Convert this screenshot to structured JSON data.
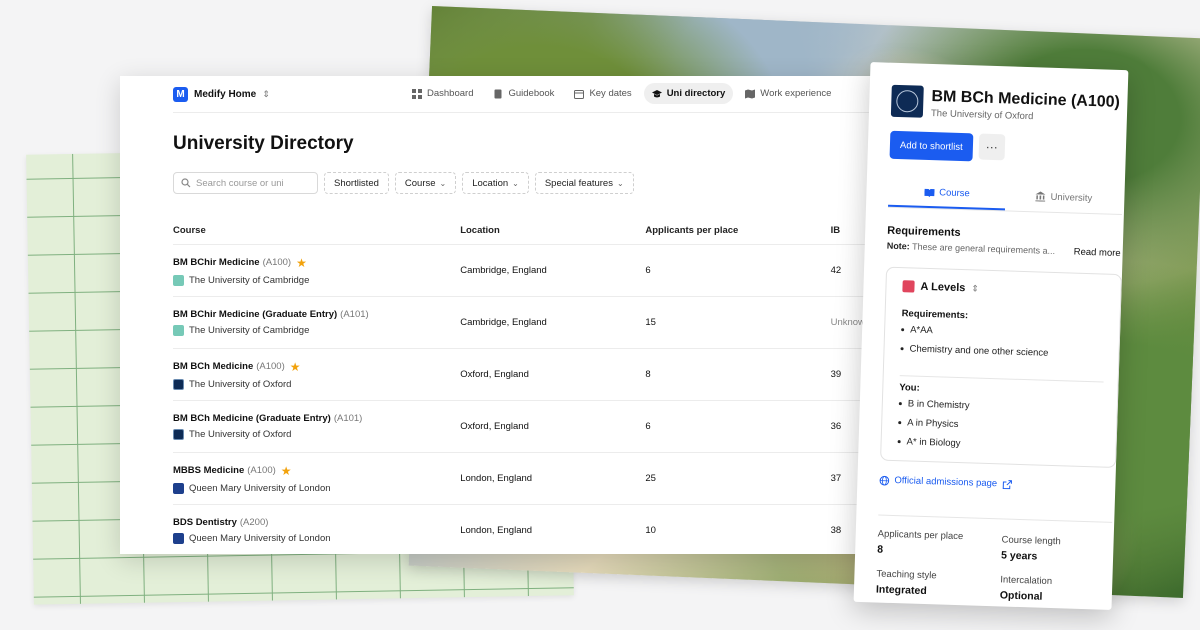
{
  "app": {
    "name": "Medify Home",
    "logo_letter": "M"
  },
  "nav": [
    {
      "label": "Dashboard",
      "icon": "dashboard-icon",
      "active": false
    },
    {
      "label": "Guidebook",
      "icon": "book-icon",
      "active": false
    },
    {
      "label": "Key dates",
      "icon": "calendar-icon",
      "active": false
    },
    {
      "label": "Uni directory",
      "icon": "graduation-cap-icon",
      "active": true
    },
    {
      "label": "Work experience",
      "icon": "map-icon",
      "active": false
    }
  ],
  "page": {
    "title": "University Directory"
  },
  "filters": {
    "search_placeholder": "Search course or uni",
    "shortlisted": "Shortlisted",
    "course": "Course",
    "location": "Location",
    "special": "Special features"
  },
  "table": {
    "headers": [
      "Course",
      "Location",
      "Applicants per place",
      "IB"
    ],
    "rows": [
      {
        "course": "BM BChir Medicine",
        "code": "(A100)",
        "star": true,
        "uni": "The University of Cambridge",
        "crest": "cam",
        "location": "Cambridge, England",
        "app": "6",
        "ib": "42"
      },
      {
        "course": "BM BChir Medicine (Graduate Entry)",
        "code": "(A101)",
        "star": false,
        "uni": "The University of Cambridge",
        "crest": "cam",
        "location": "Cambridge, England",
        "app": "15",
        "ib": "Unknown"
      },
      {
        "course": "BM BCh Medicine",
        "code": "(A100)",
        "star": true,
        "uni": "The University of Oxford",
        "crest": "ox",
        "location": "Oxford, England",
        "app": "8",
        "ib": "39"
      },
      {
        "course": "BM BCh Medicine (Graduate Entry)",
        "code": "(A101)",
        "star": false,
        "uni": "The University of Oxford",
        "crest": "ox",
        "location": "Oxford, England",
        "app": "6",
        "ib": "36"
      },
      {
        "course": "MBBS Medicine",
        "code": "(A100)",
        "star": true,
        "uni": "Queen Mary University of London",
        "crest": "qm",
        "location": "London, England",
        "app": "25",
        "ib": "37"
      },
      {
        "course": "BDS Dentistry",
        "code": "(A200)",
        "star": false,
        "uni": "Queen Mary University of London",
        "crest": "qm",
        "location": "London, England",
        "app": "10",
        "ib": "38"
      }
    ]
  },
  "panel": {
    "title": "BM BCh Medicine (A100)",
    "subtitle": "The University of Oxford",
    "add_button": "Add to shortlist",
    "more": "···",
    "tabs": [
      "Course",
      "University"
    ],
    "requirements_heading": "Requirements",
    "note_label": "Note:",
    "note_text": "These are general requirements a...",
    "read_more": "Read more",
    "qualification": "A Levels",
    "req_label": "Requirements:",
    "req_items": [
      "A*AA",
      "Chemistry and one other science"
    ],
    "you_label": "You:",
    "you_items": [
      "B in Chemistry",
      "A in Physics",
      "A* in Biology"
    ],
    "admissions_link": "Official admissions page",
    "stats": [
      {
        "label": "Applicants per place",
        "value": "8"
      },
      {
        "label": "Course length",
        "value": "5 years"
      },
      {
        "label": "Teaching style",
        "value": "Integrated"
      },
      {
        "label": "Intercalation",
        "value": "Optional"
      }
    ]
  }
}
